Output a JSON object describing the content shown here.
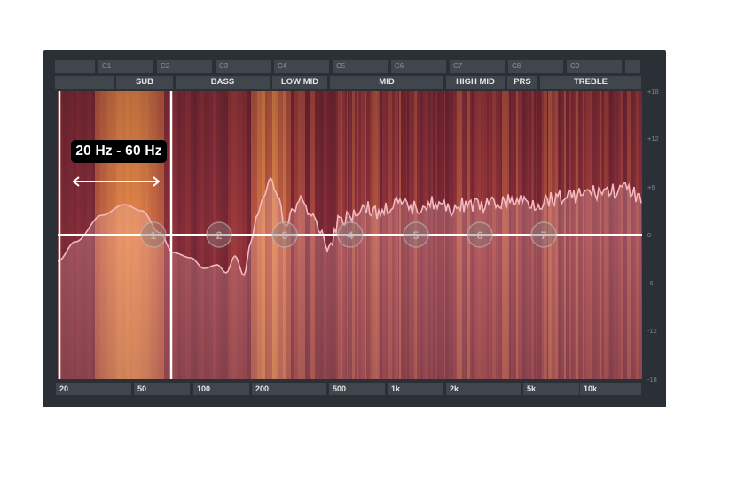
{
  "note_labels": [
    "",
    "C1",
    "C2",
    "C3",
    "C4",
    "C5",
    "C6",
    "C7",
    "C8",
    "C9",
    ""
  ],
  "bands": [
    "",
    "SUB",
    "BASS",
    "LOW MID",
    "MID",
    "HIGH MID",
    "PRS",
    "TREBLE"
  ],
  "frequency_labels": [
    "20",
    "50",
    "100",
    "200",
    "500",
    "1k",
    "2k",
    "5k",
    "10k"
  ],
  "db_labels": [
    "+18",
    "+12",
    "+6",
    "0",
    "-6",
    "-12",
    "-18"
  ],
  "eq_nodes": [
    "1",
    "2",
    "3",
    "4",
    "5",
    "6",
    "7"
  ],
  "highlight": {
    "label": "20 Hz - 60 Hz",
    "range_hz": [
      20,
      60
    ]
  },
  "colors": {
    "panel": "#2b3036",
    "cell": "#41464d",
    "spectrum_base": "#7a2a3e",
    "spectrum_hot": "#e88a4a",
    "curve": "#f3b9c0",
    "zero_line": "#ffffff",
    "callout_bg": "#000000"
  }
}
